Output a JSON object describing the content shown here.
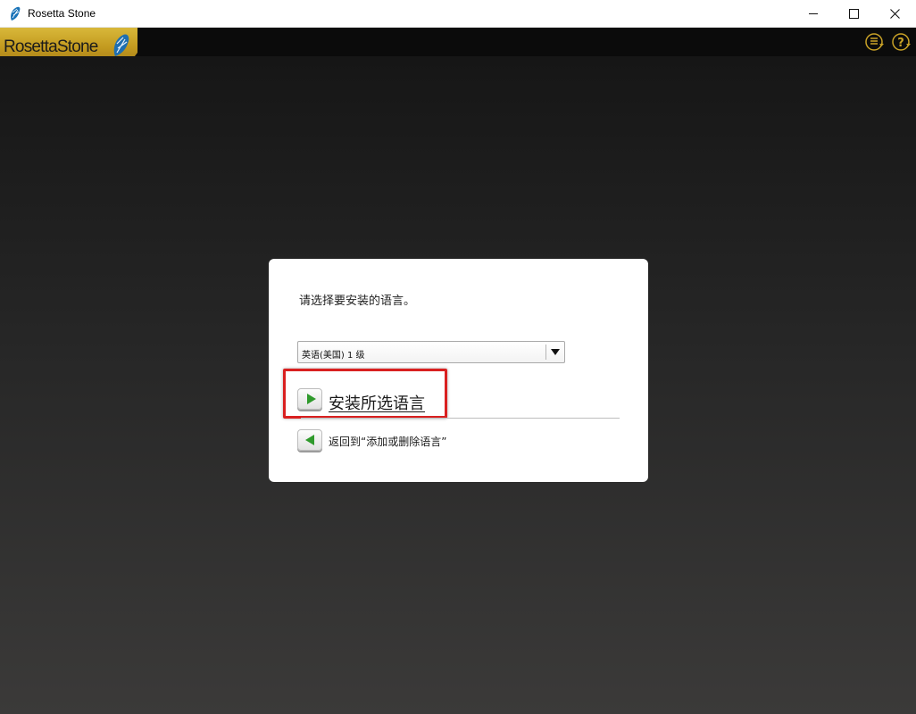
{
  "window": {
    "title": "Rosetta Stone",
    "controls": {
      "minimize": "minimize-icon",
      "maximize": "maximize-icon",
      "close": "close-icon"
    }
  },
  "header": {
    "logo_text": "RosettaStone",
    "icons": [
      "menu-list-icon",
      "help-icon"
    ],
    "accent": "#c9a227"
  },
  "dialog": {
    "prompt": "请选择要安装的语言。",
    "language_select": {
      "selected": "英语(美国) 1 级"
    },
    "install_button": {
      "label": "安装所选语言",
      "icon": "play-right-icon"
    },
    "back_button": {
      "label": "返回到“添加或删除语言”",
      "icon": "back-left-icon"
    },
    "highlight_color": "#d92020",
    "button_arrow_color": "#2f9a2c"
  }
}
